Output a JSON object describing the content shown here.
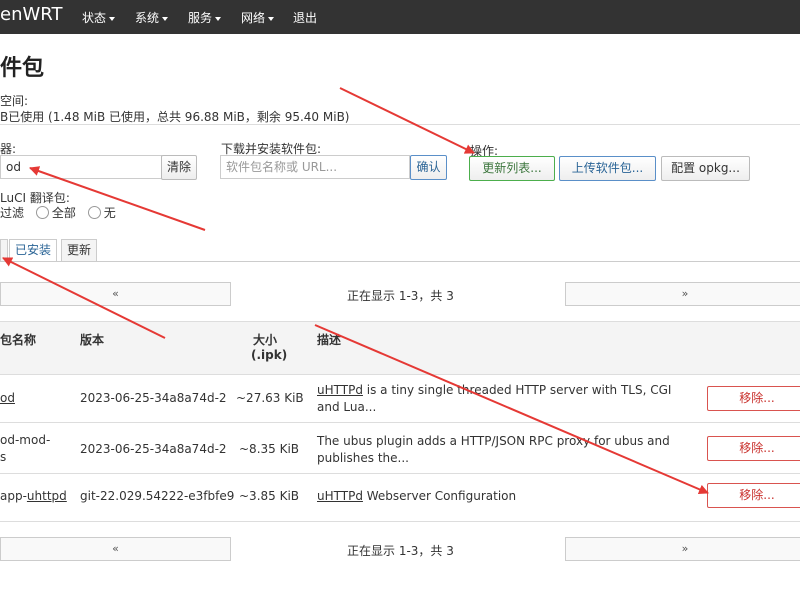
{
  "nav": {
    "brand": "enWRT",
    "menu": [
      "状态",
      "系统",
      "服务",
      "网络",
      "退出"
    ]
  },
  "page": {
    "title": "件包",
    "space_label": "空间:",
    "space_usage": "B已使用 (1.48 MiB 已使用，总共 96.88 MiB，剩余 95.40 MiB)"
  },
  "filter": {
    "label": "器:",
    "value": "od",
    "clear_label": "清除"
  },
  "download": {
    "label": "下载并安装软件包:",
    "placeholder": "软件包名称或 URL...",
    "confirm_label": "确认"
  },
  "actions": {
    "label": "操作:",
    "update_lists": "更新列表...",
    "upload_package": "上传软件包...",
    "configure_opkg": "配置 opkg..."
  },
  "translation": {
    "label": "LuCI 翻译包:",
    "options": [
      "过滤",
      "全部",
      "无"
    ]
  },
  "tabs": [
    "已安装",
    "更新"
  ],
  "pagination": {
    "prev": "«",
    "next": "»",
    "status": "正在显示 1-3，共 3"
  },
  "table": {
    "headers": {
      "name": "包名称",
      "version": "版本",
      "size_line1": "大小",
      "size_line2": "(.ipk)",
      "description": "描述"
    },
    "rows": [
      {
        "name_line1": "od",
        "name_line2": "",
        "version": "2023-06-25-34a8a74d-2",
        "size": "~27.63 KiB",
        "desc_prefix": "uHTTPd",
        "desc_rest": " is a tiny single threaded HTTP server with TLS, CGI and Lua...",
        "action": "移除..."
      },
      {
        "name_line1": "od-mod-",
        "name_line2": "s",
        "version": "2023-06-25-34a8a74d-2",
        "size": "~8.35 KiB",
        "desc_prefix": "",
        "desc_rest": "The ubus plugin adds a HTTP/JSON RPC proxy for ubus and publishes the...",
        "action": "移除..."
      },
      {
        "name_line1": "app-",
        "name_link": "uhttpd",
        "name_line2": "",
        "version": "git-22.029.54222-e3fbfe9",
        "size": "~3.85 KiB",
        "desc_prefix": "uHTTPd",
        "desc_rest": " Webserver Configuration",
        "action": "移除..."
      }
    ]
  },
  "colors": {
    "topbar": "#333333",
    "annotation_arrow": "#e53935",
    "danger": "#d9534f",
    "success": "#4cae4c",
    "primary": "#2a6496"
  }
}
